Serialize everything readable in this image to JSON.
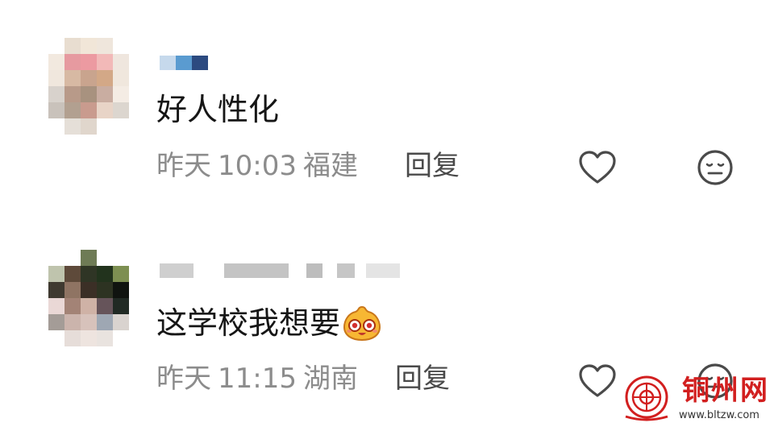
{
  "comments": [
    {
      "content": "好人性化",
      "meta": {
        "day": "昨天",
        "time": "10:03",
        "location": "福建"
      },
      "reply_label": "回复"
    },
    {
      "content": "这学校我想要",
      "meta": {
        "day": "昨天",
        "time": "11:15",
        "location": "湖南"
      },
      "reply_label": "回复",
      "emoji": "laughing-emoji"
    }
  ],
  "icons": {
    "like": "heart-icon",
    "dislike": "meh-face-icon"
  },
  "watermark": {
    "title": "铜州网",
    "url": "www.bltzw.com",
    "color": "#d21f1f"
  }
}
